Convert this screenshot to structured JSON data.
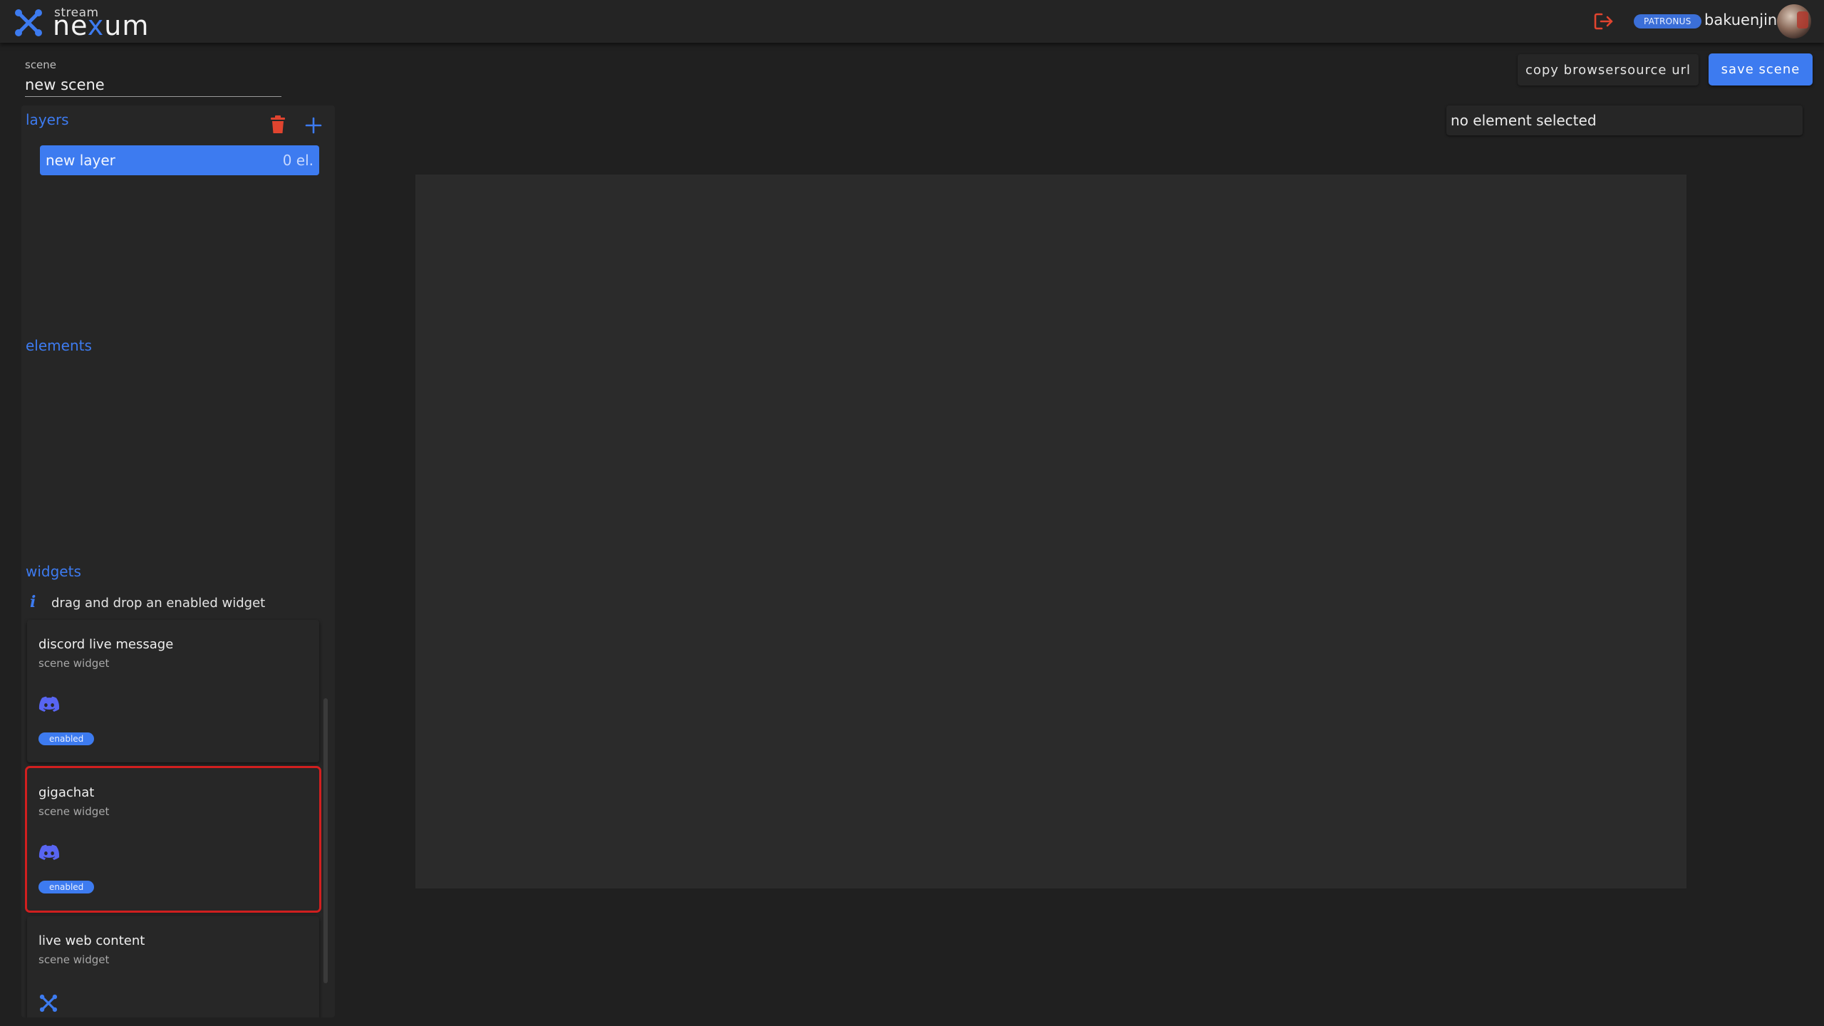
{
  "header": {
    "logo_small": "stream",
    "logo_prefix": "ne",
    "logo_x": "x",
    "logo_suffix": "um",
    "patron_badge": "PATRONUS",
    "username": "bakuenjin",
    "accent_color": "#3d7bf0",
    "logout_color": "#e0442f"
  },
  "scene": {
    "label": "scene",
    "name": "new scene"
  },
  "toolbar": {
    "copy_url_label": "copy browsersource url",
    "save_label": "save scene"
  },
  "selection": {
    "status_text": "no element selected"
  },
  "layers": {
    "title": "layers",
    "items": [
      {
        "name": "new layer",
        "count": "0 el."
      }
    ]
  },
  "elements": {
    "title": "elements"
  },
  "widgets": {
    "title": "widgets",
    "info_text": "drag and drop an enabled widget",
    "items": [
      {
        "title": "discord live message",
        "subtitle": "scene widget",
        "icon": "discord-icon",
        "status": "enabled"
      },
      {
        "title": "gigachat",
        "subtitle": "scene widget",
        "icon": "discord-icon",
        "status": "enabled"
      },
      {
        "title": "live web content",
        "subtitle": "scene widget",
        "icon": "nexum-icon"
      }
    ]
  }
}
